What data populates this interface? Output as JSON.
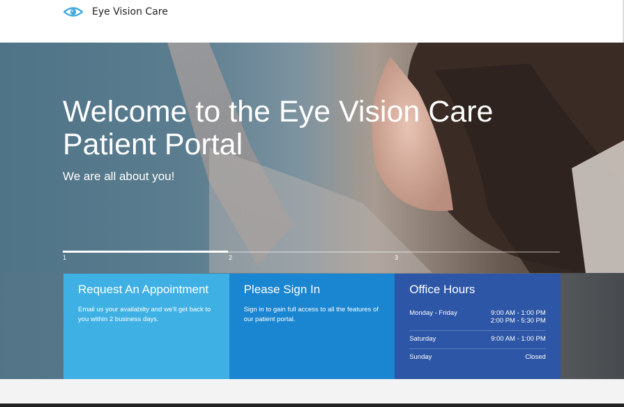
{
  "brand": {
    "name": "Eye Vision Care",
    "accent": "#3fa9dc"
  },
  "hero": {
    "title": "Welcome to the Eye Vision Care Patient Portal",
    "subtitle": "We are all about you!",
    "slider": {
      "steps": [
        "1",
        "2",
        "3"
      ],
      "active_progress": 0.333
    }
  },
  "panels": {
    "appointment": {
      "title": "Request An Appointment",
      "text": "Email us your availabilty and we'll get back to you within 2 business days.",
      "color": "#3fb0e3"
    },
    "signin": {
      "title": "Please Sign In",
      "text": "Sign in to gain full access to all the features of our patient portal.",
      "color": "#1a85d0"
    },
    "hours": {
      "title": "Office Hours",
      "color": "#2d56a6",
      "rows": [
        {
          "day": "Monday - Friday",
          "time": "9:00 AM - 1:00 PM\n2:00 PM - 5:30 PM"
        },
        {
          "day": "Saturday",
          "time": "9:00 AM - 1:00 PM"
        },
        {
          "day": "Sunday",
          "time": "Closed"
        }
      ]
    }
  }
}
